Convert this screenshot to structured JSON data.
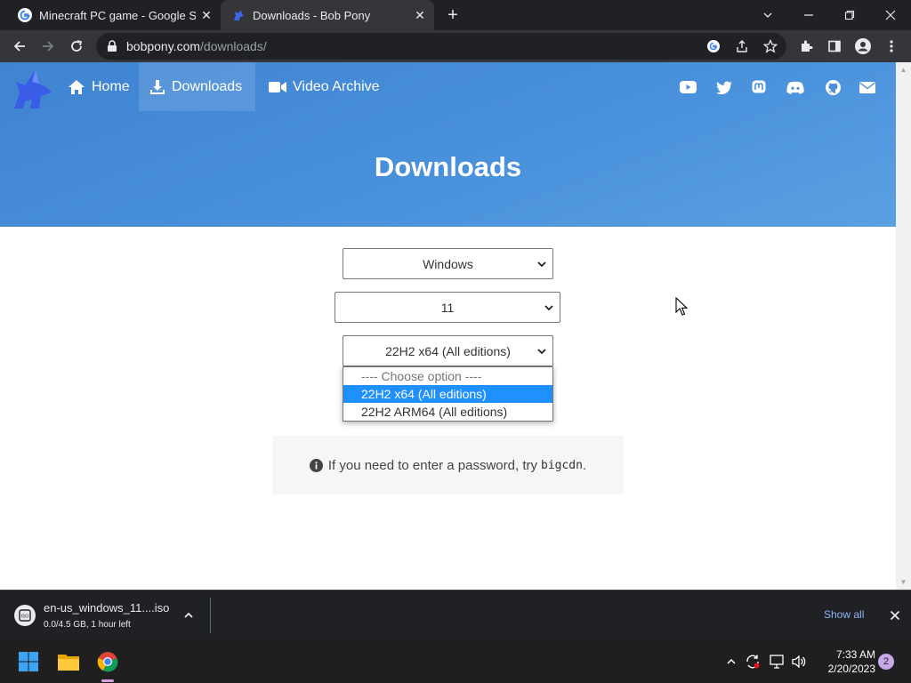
{
  "browser": {
    "tabs": [
      {
        "title": "Minecraft PC game - Google Search",
        "favicon": "google-g-icon"
      },
      {
        "title": "Downloads - Bob Pony",
        "favicon": "bob-pony-icon",
        "active": true
      }
    ],
    "url_host": "bobpony.com",
    "url_path": "/downloads/"
  },
  "site": {
    "nav": [
      {
        "label": "Home",
        "icon": "home-icon"
      },
      {
        "label": "Downloads",
        "icon": "download-icon",
        "active": true
      },
      {
        "label": "Video Archive",
        "icon": "video-camera-icon"
      }
    ],
    "social_icons": [
      "youtube-icon",
      "twitter-icon",
      "mastodon-icon",
      "discord-icon",
      "github-icon",
      "email-icon"
    ],
    "page_title": "Downloads",
    "colors": {
      "hero": "#4a90d9",
      "selected_option": "#1e90ff"
    }
  },
  "form": {
    "os_select": "Windows",
    "version_select": "11",
    "build_select": "22H2 x64 (All editions)",
    "build_options": [
      {
        "label": "---- Choose option ----",
        "selected": false
      },
      {
        "label": "22H2 x64 (All editions)",
        "selected": true
      },
      {
        "label": "22H2 ARM64 (All editions)",
        "selected": false
      }
    ]
  },
  "info": {
    "text": "If you need to enter a password, try",
    "code": "bigcdn",
    "suffix": "."
  },
  "download_shelf": {
    "filename": "en-us_windows_11....iso",
    "status": "0.0/4.5 GB, 1 hour left",
    "show_all": "Show all"
  },
  "taskbar": {
    "time": "7:33 AM",
    "date": "2/20/2023",
    "notification_count": "2"
  }
}
